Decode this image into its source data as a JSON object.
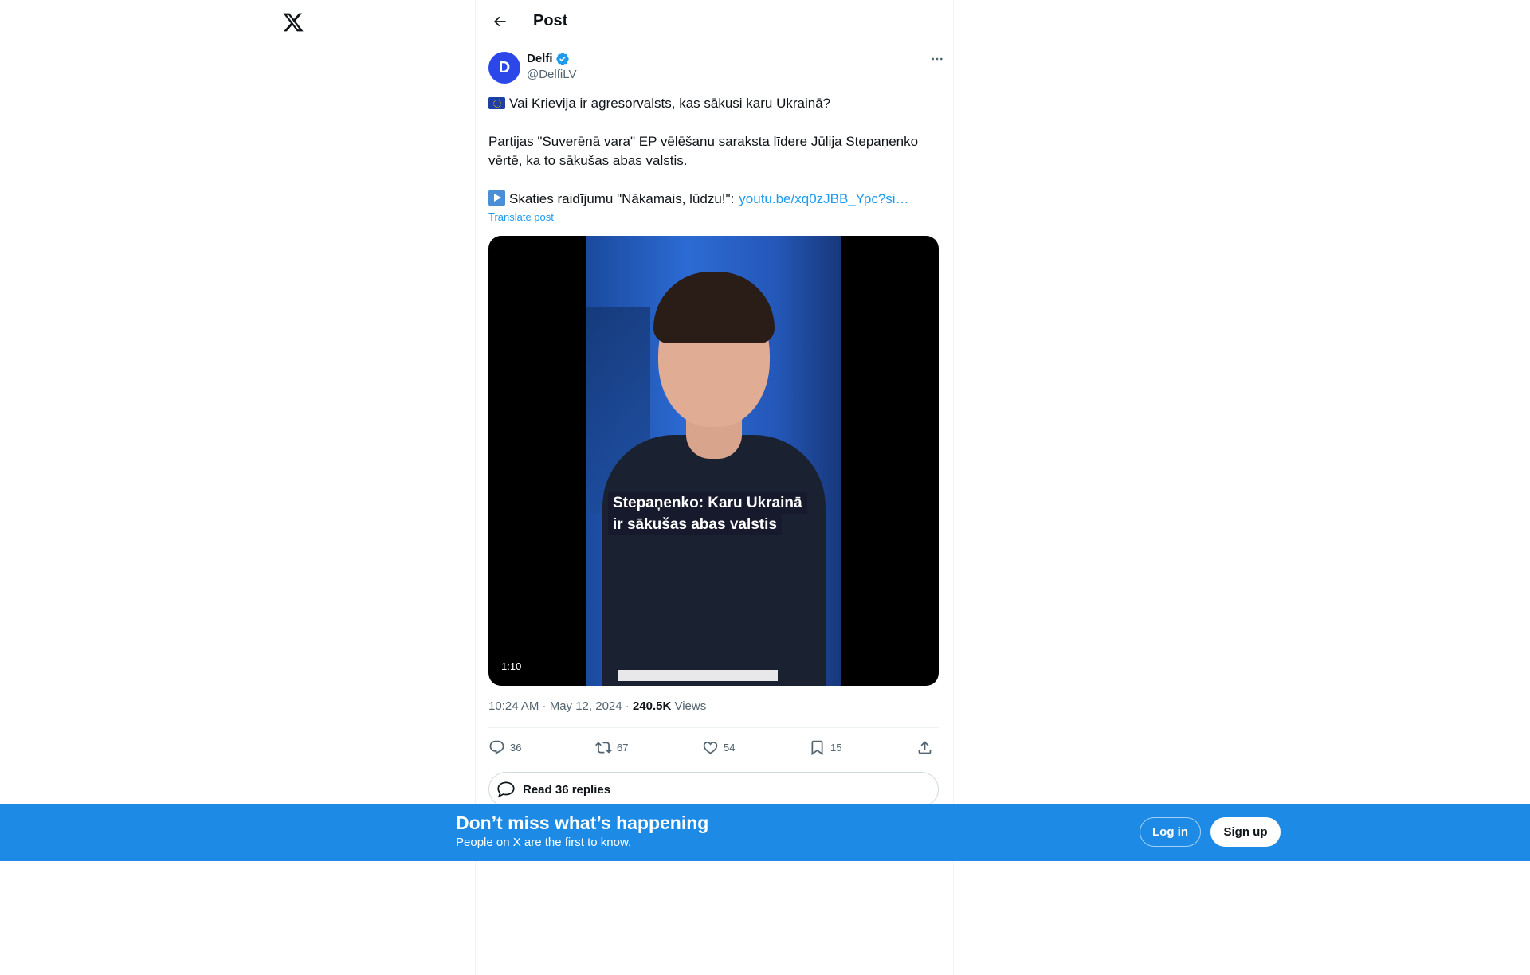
{
  "header": {
    "title": "Post"
  },
  "post": {
    "author": {
      "name": "Delfi",
      "handle": "@DelfiLV",
      "avatar_initial": "D",
      "verified": true
    },
    "text_line1": "Vai Krievija ir agresorvalsts, kas sākusi karu Ukrainā?",
    "text_line2a": "Partijas \"Suverēnā vara\" EP vēlēšanu saraksta līdere Jūlija Stepaņenko",
    "text_line2b": "vērtē, ka to sākušas abas valstis.",
    "text_line3": "Skaties raidījumu \"Nākamais, lūdzu!\":",
    "link": "youtu.be/xq0zJBB_Ypc?si…",
    "translate_label": "Translate post",
    "video": {
      "caption_line1": "Stepaņenko: Karu Ukrainā",
      "caption_line2": "ir sākušas abas valstis",
      "duration": "1:10"
    },
    "meta": {
      "time_date": "10:24 AM · May 12, 2024 · ",
      "views_count": "240.5K",
      "views_label": " Views"
    },
    "stats": {
      "replies": "36",
      "reposts": "67",
      "likes": "54",
      "bookmarks": "15"
    },
    "read_replies_label": "Read 36 replies"
  },
  "banner": {
    "title": "Don’t miss what’s happening",
    "subtitle": "People on X are the first to know.",
    "login_label": "Log in",
    "signup_label": "Sign up"
  },
  "colors": {
    "accent": "#1d9bf0",
    "banner": "#1d8be6",
    "avatar": "#2b47e8"
  }
}
